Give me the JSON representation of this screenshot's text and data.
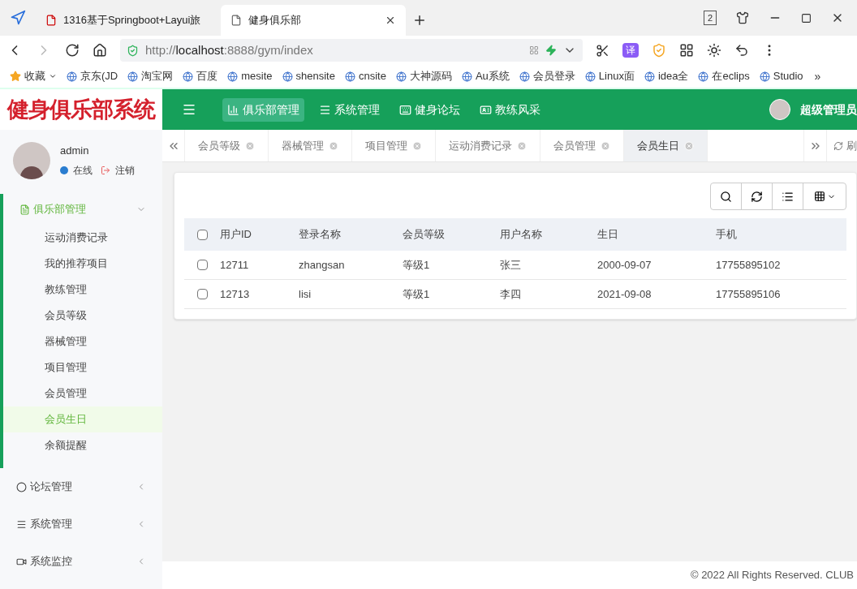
{
  "browser": {
    "tabs": [
      {
        "title": "1316基于Springboot+Layui旅",
        "selected": false
      },
      {
        "title": "健身俱乐部",
        "selected": true
      }
    ],
    "tab_count": "2",
    "url_prefix": "http://",
    "url_host": "localhost",
    "url_rest": ":8888/gym/index",
    "translate": "译",
    "bookmarks": [
      {
        "kind": "favorites",
        "label": "收藏"
      },
      {
        "kind": "link",
        "label": "京东(JD"
      },
      {
        "kind": "link",
        "label": "淘宝网"
      },
      {
        "kind": "link",
        "label": "百度"
      },
      {
        "kind": "link",
        "label": "mesite"
      },
      {
        "kind": "link",
        "label": "shensite"
      },
      {
        "kind": "link",
        "label": "cnsite"
      },
      {
        "kind": "link",
        "label": "大神源码"
      },
      {
        "kind": "link",
        "label": "Au系统"
      },
      {
        "kind": "link",
        "label": "会员登录"
      },
      {
        "kind": "link",
        "label": "Linux面"
      },
      {
        "kind": "link",
        "label": "idea全"
      },
      {
        "kind": "link",
        "label": "在eclips"
      },
      {
        "kind": "link",
        "label": "Studio"
      },
      {
        "kind": "more",
        "label": "»"
      }
    ]
  },
  "app": {
    "logo": "健身俱乐部系统",
    "nav": [
      {
        "kind": "chart",
        "label": "俱乐部管理",
        "selected": true
      },
      {
        "kind": "list",
        "label": "系统管理",
        "selected": false
      },
      {
        "kind": "keyboard",
        "label": "健身论坛",
        "selected": false
      },
      {
        "kind": "card",
        "label": "教练风采",
        "selected": false
      }
    ],
    "user_name": "超级管理员",
    "sidebar": {
      "user": {
        "name": "admin",
        "status": "在线",
        "logout": "注销"
      },
      "groups": [
        {
          "kind": "file",
          "label": "俱乐部管理",
          "expanded": true,
          "children": [
            {
              "label": "运动消费记录",
              "selected": false
            },
            {
              "label": "我的推荐项目",
              "selected": false
            },
            {
              "label": "教练管理",
              "selected": false
            },
            {
              "label": "会员等级",
              "selected": false
            },
            {
              "label": "器械管理",
              "selected": false
            },
            {
              "label": "项目管理",
              "selected": false
            },
            {
              "label": "会员管理",
              "selected": false
            },
            {
              "label": "会员生日",
              "selected": true
            },
            {
              "label": "余额提醒",
              "selected": false
            }
          ]
        },
        {
          "kind": "circle",
          "label": "论坛管理",
          "expanded": false
        },
        {
          "kind": "list",
          "label": "系统管理",
          "expanded": false
        },
        {
          "kind": "video",
          "label": "系统监控",
          "expanded": false
        }
      ]
    },
    "tabs": [
      {
        "label": "会员等级",
        "selected": false
      },
      {
        "label": "器械管理",
        "selected": false
      },
      {
        "label": "项目管理",
        "selected": false
      },
      {
        "label": "运动消费记录",
        "selected": false
      },
      {
        "label": "会员管理",
        "selected": false
      },
      {
        "label": "会员生日",
        "selected": true
      }
    ],
    "refresh": "刷",
    "table": {
      "columns": [
        "用户ID",
        "登录名称",
        "会员等级",
        "用户名称",
        "生日",
        "手机"
      ],
      "header_checked": false,
      "rows": [
        {
          "checked": false,
          "cells": [
            "12711",
            "zhangsan",
            "等级1",
            "张三",
            "2000-09-07",
            "17755895102"
          ]
        },
        {
          "checked": false,
          "cells": [
            "12713",
            "lisi",
            "等级1",
            "李四",
            "2021-09-08",
            "17755895106"
          ]
        }
      ]
    },
    "footer": "© 2022 All Rights Reserved. CLUB"
  }
}
